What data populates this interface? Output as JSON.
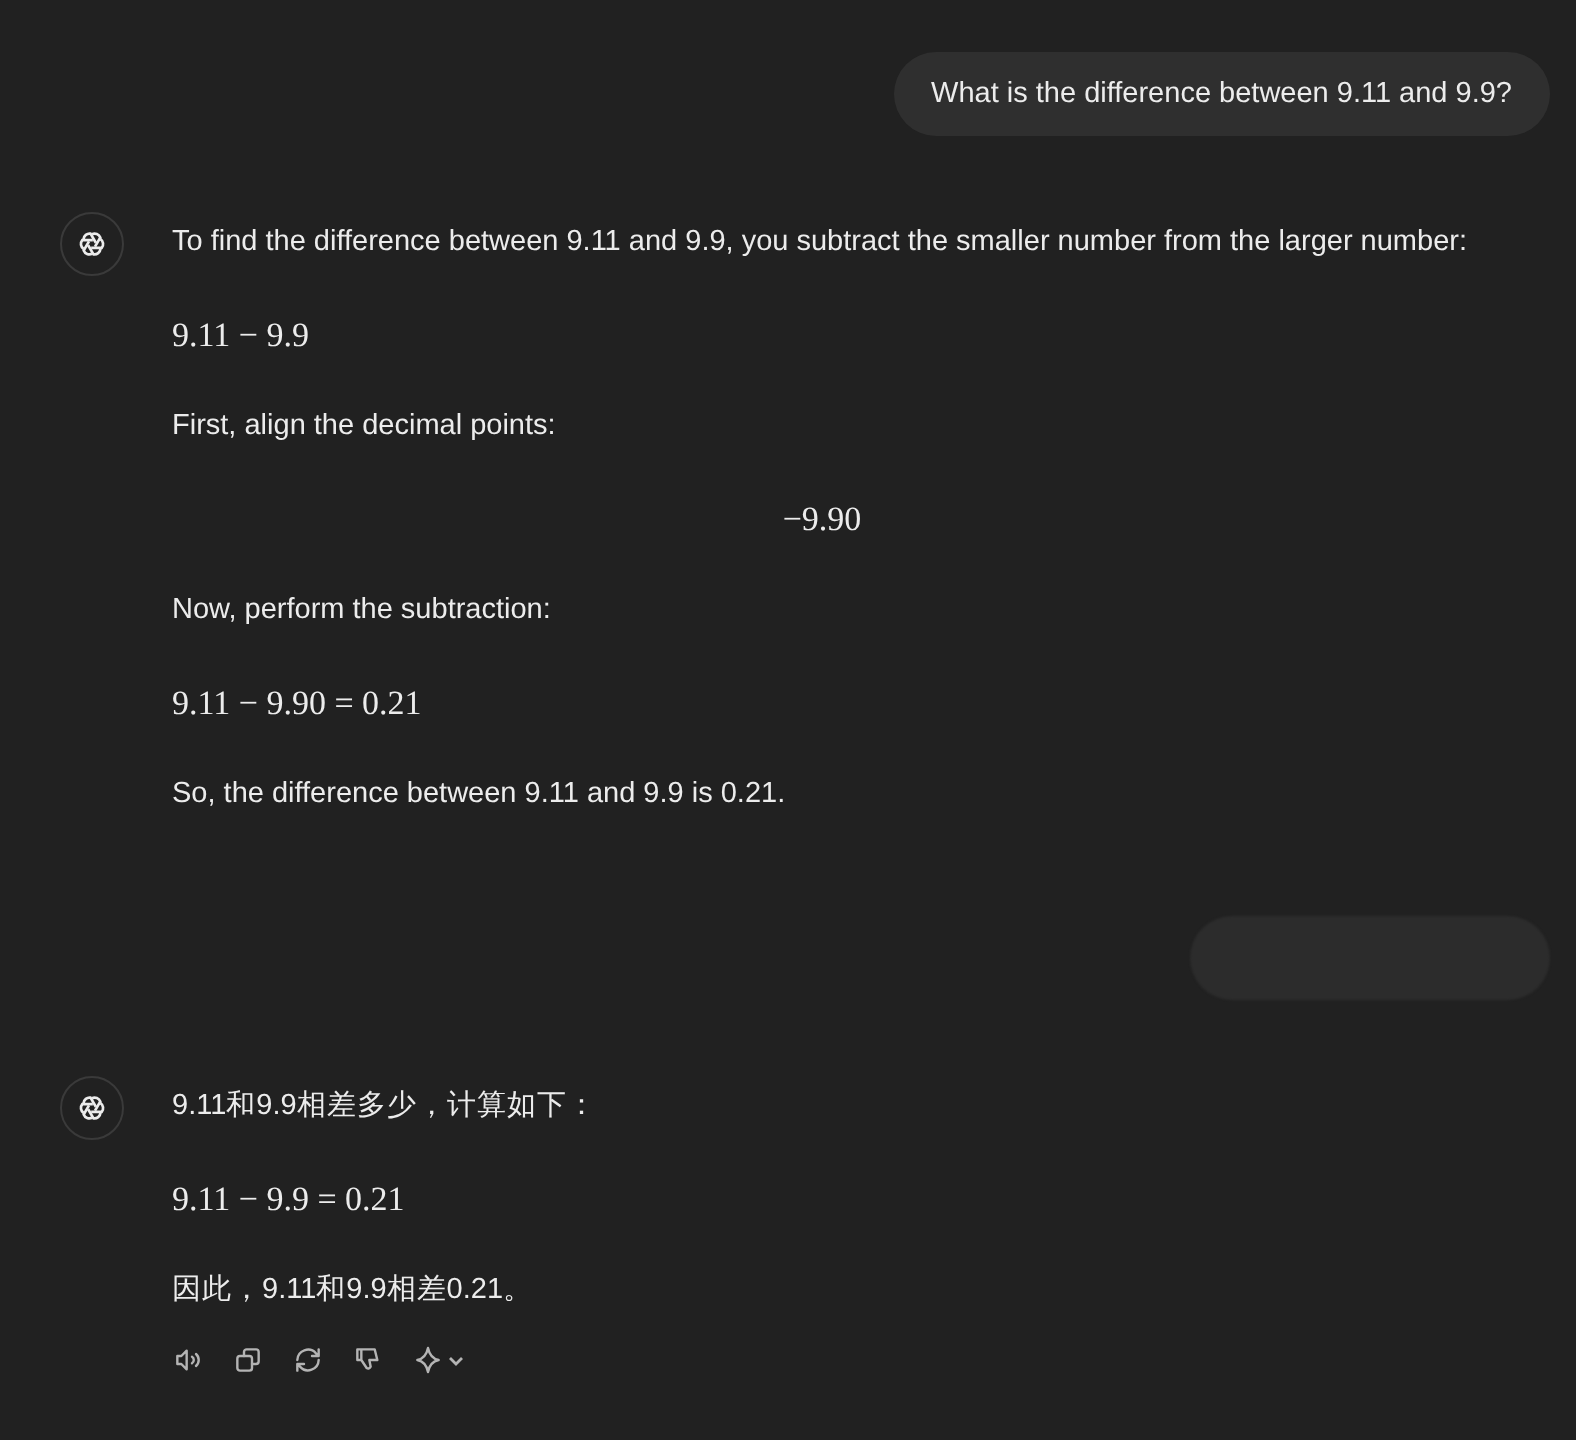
{
  "messages": [
    {
      "kind": "user",
      "text": "What is the difference between 9.11 and 9.9?"
    },
    {
      "kind": "assistant",
      "actions": false,
      "blocks": [
        {
          "kind": "text",
          "text": "To find the difference between 9.11 and 9.9, you subtract the smaller number from the larger number:"
        },
        {
          "kind": "math",
          "text": "9.11 − 9.9"
        },
        {
          "kind": "text",
          "text": "First, align the decimal points:"
        },
        {
          "kind": "math_center",
          "text": "−9.90"
        },
        {
          "kind": "text",
          "text": "Now, perform the subtraction:"
        },
        {
          "kind": "math",
          "text": "9.11 − 9.90 = 0.21"
        },
        {
          "kind": "text",
          "text": "So, the difference between 9.11 and 9.9 is 0.21."
        }
      ]
    },
    {
      "kind": "hidden_user"
    },
    {
      "kind": "assistant",
      "actions": true,
      "blocks": [
        {
          "kind": "text",
          "text": "9.11和9.9相差多少，计算如下："
        },
        {
          "kind": "math",
          "text": "9.11 − 9.9 = 0.21"
        },
        {
          "kind": "text",
          "text": "因此，9.11和9.9相差0.21。"
        }
      ]
    }
  ]
}
